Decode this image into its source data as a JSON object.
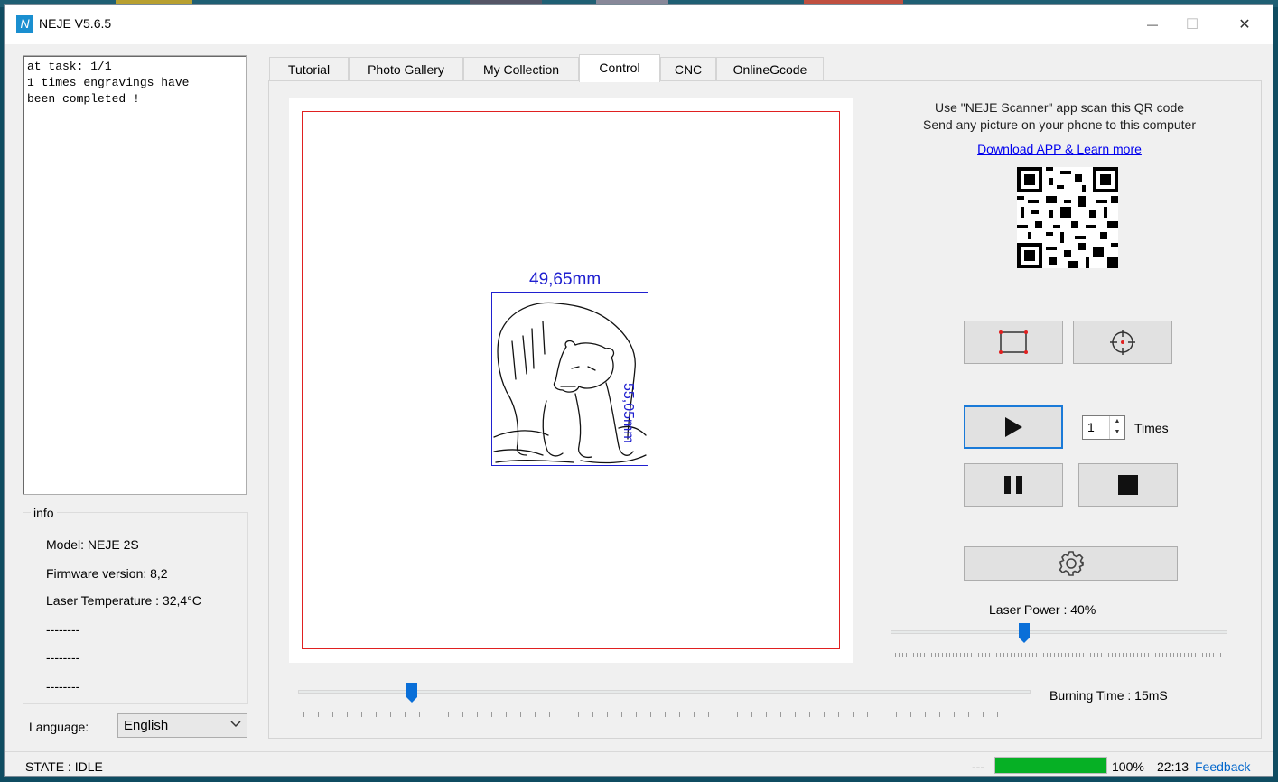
{
  "window": {
    "title": "NEJE V5.6.5",
    "logo_glyph": "N",
    "minimize_glyph": "—",
    "maximize_glyph": "☐",
    "close_glyph": "✕"
  },
  "log": {
    "text": "at task: 1/1\n1 times engravings have\nbeen completed !"
  },
  "info": {
    "legend": "info",
    "model": "Model: NEJE 2S",
    "firmware": "Firmware version: 8,2",
    "temperature": "Laser Temperature : 32,4°C",
    "line4": "--------",
    "line5": "--------",
    "line6": "--------"
  },
  "language": {
    "label": "Language:",
    "selected": "English"
  },
  "tabs": [
    {
      "label": "Tutorial"
    },
    {
      "label": "Photo Gallery"
    },
    {
      "label": "My Collection"
    },
    {
      "label": "Control"
    },
    {
      "label": "CNC"
    },
    {
      "label": "OnlineGcode"
    }
  ],
  "canvas": {
    "width_label": "49,65mm",
    "height_label": "55,05mm"
  },
  "qr_panel": {
    "line1": "Use \"NEJE Scanner\" app scan this QR code",
    "line2": "Send any picture on your phone to this computer",
    "link": "Download APP & Learn more"
  },
  "controls": {
    "times_value": "1",
    "times_label": "Times",
    "laser_power_label": "Laser Power : 40%",
    "laser_power_fraction": 0.4,
    "burning_time_label": "Burning Time : 15mS",
    "burning_time_fraction": 0.15
  },
  "status": {
    "state": "STATE : IDLE",
    "dashes": "---",
    "progress_percent": 100,
    "percent_label": "100%",
    "time": "22:13",
    "feedback": "Feedback"
  },
  "colors": {
    "frame_red": "#e02020",
    "dimension_blue": "#2020d0",
    "progress_green": "#06b025",
    "slider_blue": "#0a6fd8"
  }
}
